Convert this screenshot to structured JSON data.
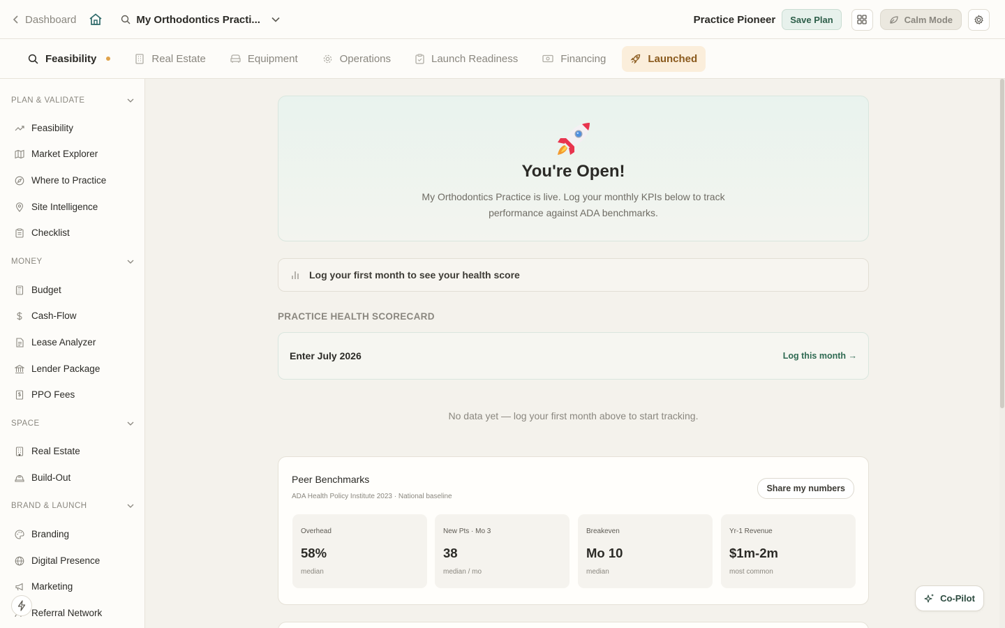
{
  "topbar": {
    "back_label": "Dashboard",
    "project_name": "My Orthodontics Practi...",
    "brand": "Practice Pioneer",
    "save_label": "Save Plan",
    "calm_label": "Calm Mode"
  },
  "tabs": [
    {
      "label": "Feasibility",
      "icon": "search-icon",
      "state": "active"
    },
    {
      "label": "Real Estate",
      "icon": "building-icon"
    },
    {
      "label": "Equipment",
      "icon": "chair-icon"
    },
    {
      "label": "Operations",
      "icon": "gear-icon"
    },
    {
      "label": "Launch Readiness",
      "icon": "clipboard-icon"
    },
    {
      "label": "Financing",
      "icon": "banknote-icon"
    },
    {
      "label": "Launched",
      "icon": "rocket-icon",
      "state": "highlighted"
    }
  ],
  "sidebar": {
    "sections": [
      {
        "title": "PLAN & VALIDATE",
        "items": [
          "Feasibility",
          "Market Explorer",
          "Where to Practice",
          "Site Intelligence",
          "Checklist"
        ]
      },
      {
        "title": "MONEY",
        "items": [
          "Budget",
          "Cash-Flow",
          "Lease Analyzer",
          "Lender Package",
          "PPO Fees"
        ]
      },
      {
        "title": "SPACE",
        "items": [
          "Real Estate",
          "Build-Out"
        ]
      },
      {
        "title": "BRAND & LAUNCH",
        "items": [
          "Branding",
          "Digital Presence",
          "Marketing",
          "Referral Network"
        ]
      }
    ]
  },
  "hero": {
    "title": "You're Open!",
    "description": "My Orthodontics Practice is live. Log your monthly KPIs below to track performance against ADA benchmarks."
  },
  "health_prompt": "Log your first month to see your health score",
  "scorecard": {
    "title": "PRACTICE HEALTH SCORECARD",
    "enter_label": "Enter July 2026",
    "log_link": "Log this month →",
    "empty_text": "No data yet — log your first month above to start tracking."
  },
  "peer": {
    "title": "Peer Benchmarks",
    "source": "ADA Health Policy Institute 2023 · National baseline",
    "share_label": "Share my numbers",
    "cards": [
      {
        "title": "Overhead",
        "value": "58%",
        "sub": "median"
      },
      {
        "title": "New Pts · Mo 3",
        "value": "38",
        "sub": "median / mo"
      },
      {
        "title": "Breakeven",
        "value": "Mo 10",
        "sub": "median"
      },
      {
        "title": "Yr-1 Revenue",
        "value": "$1m-2m",
        "sub": "most common"
      }
    ]
  },
  "copilot_label": "Co-Pilot",
  "colors": {
    "accent_green": "#2f6a52",
    "launched_bg": "#fbeedb",
    "background": "#f4f2ec"
  }
}
